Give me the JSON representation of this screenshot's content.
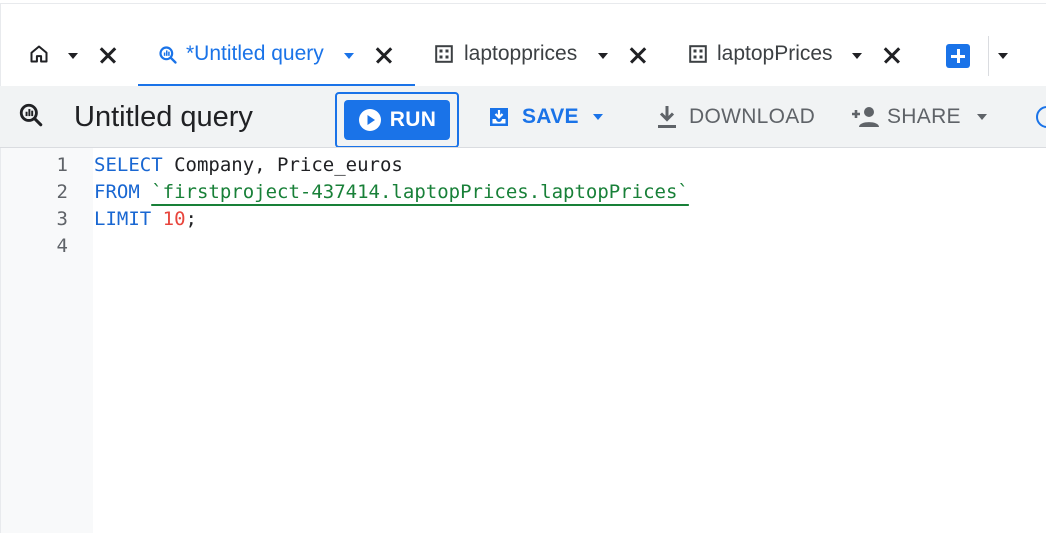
{
  "tabs": [
    {
      "id": "home",
      "label": "",
      "icon": "home-icon",
      "active": false
    },
    {
      "id": "untitled",
      "label": "*Untitled query",
      "icon": "query-icon",
      "active": true
    },
    {
      "id": "laptopprices",
      "label": "laptopprices",
      "icon": "table-icon",
      "active": false
    },
    {
      "id": "laptopPrices",
      "label": "laptopPrices",
      "icon": "table-icon",
      "active": false
    }
  ],
  "toolbar": {
    "query_title": "Untitled query",
    "run_label": "RUN",
    "save_label": "SAVE",
    "download_label": "DOWNLOAD",
    "share_label": "SHARE"
  },
  "editor": {
    "line_numbers": [
      "1",
      "2",
      "3",
      "4"
    ],
    "lines": {
      "l1_kw": "SELECT",
      "l1_rest": " Company, Price_euros",
      "l2_kw": "FROM",
      "l2_sp": " ",
      "l2_table": "`firstproject-437414.laptopPrices.laptopPrices`",
      "l3_kw": "LIMIT",
      "l3_sp": " ",
      "l3_num": "10",
      "l3_end": ";"
    }
  },
  "colors": {
    "accent": "#1a73e8",
    "keyword": "#1967d2",
    "table_ref": "#188038",
    "number": "#e8453c",
    "toolbar_bg": "#f1f3f4"
  }
}
